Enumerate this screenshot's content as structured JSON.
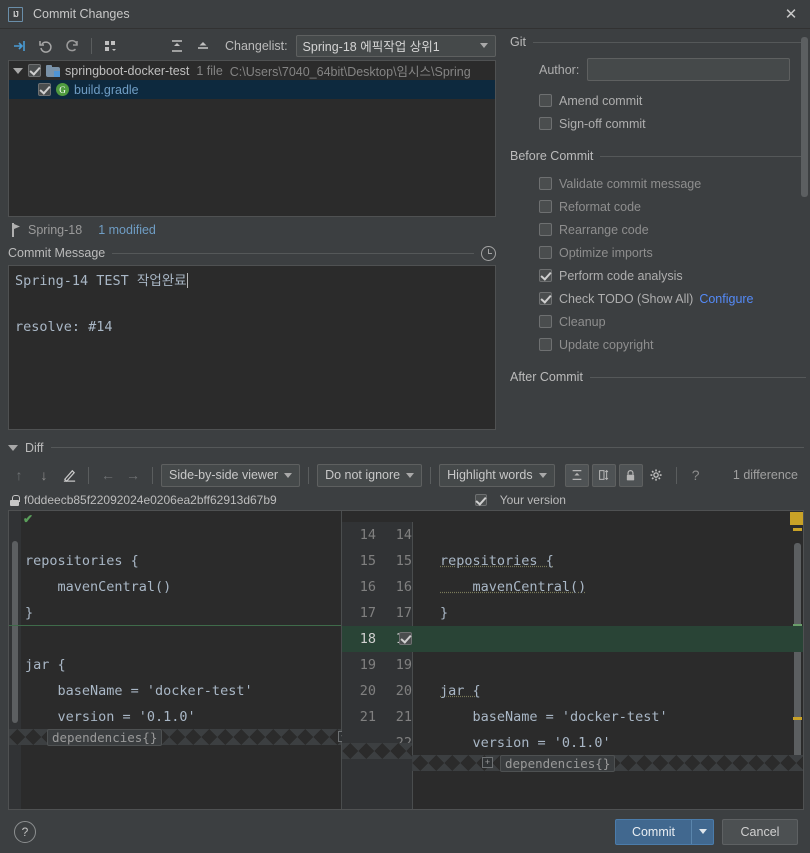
{
  "window": {
    "title": "Commit Changes",
    "logo": "ij-logo",
    "close": "✕"
  },
  "changes_toolbar": {
    "icons": [
      {
        "name": "show-diff-icon",
        "glyph": "⇥"
      },
      {
        "name": "revert-icon",
        "glyph": "↺"
      },
      {
        "name": "refresh-icon",
        "glyph": "⟳"
      },
      {
        "name": "group-by-icon",
        "glyph": "⣿"
      },
      {
        "name": "expand-all-icon",
        "glyph": "⤒"
      },
      {
        "name": "collapse-all-icon",
        "glyph": "⤓"
      }
    ],
    "changelist_label": "Changelist:",
    "changelist_value": "Spring-18 에픽작업 상위1"
  },
  "file_tree": {
    "root": {
      "name": "springboot-docker-test",
      "file_count": "1 file",
      "path": "C:\\Users\\7040_64bit\\Desktop\\임시스\\Spring",
      "checked": true,
      "expanded": true
    },
    "children": [
      {
        "name": "build.gradle",
        "checked": true,
        "selected": true,
        "icon": "gradle-file-icon"
      }
    ]
  },
  "branch_status": {
    "branch": "Spring-18",
    "modified": "1 modified"
  },
  "commit_message": {
    "label": "Commit Message",
    "history_icon": "clock-icon",
    "line1": "Spring-14 TEST 작업완료",
    "line2": "",
    "line3": "resolve: #14"
  },
  "git_group": {
    "title": "Git",
    "author_label": "Author:",
    "author_value": "",
    "author_placeholder": "",
    "options": [
      {
        "label": "Amend commit",
        "checked": false
      },
      {
        "label": "Sign-off commit",
        "checked": false
      }
    ]
  },
  "before_commit_group": {
    "title": "Before Commit",
    "options": [
      {
        "label": "Validate commit message",
        "checked": false
      },
      {
        "label": "Reformat code",
        "checked": false
      },
      {
        "label": "Rearrange code",
        "checked": false
      },
      {
        "label": "Optimize imports",
        "checked": false
      },
      {
        "label": "Perform code analysis",
        "checked": true
      },
      {
        "label": "Check TODO (Show All)",
        "checked": true,
        "link": "Configure"
      },
      {
        "label": "Cleanup",
        "checked": false
      },
      {
        "label": "Update copyright",
        "checked": false
      }
    ]
  },
  "after_commit_group": {
    "title": "After Commit"
  },
  "diff": {
    "title": "Diff",
    "toolbar": {
      "prev_diff": "↑",
      "next_diff": "↓",
      "edit": "✎",
      "accept_left": "←",
      "accept_right": "→",
      "viewer_mode": "Side-by-side viewer",
      "ignore_mode": "Do not ignore",
      "highlight_mode": "Highlight words",
      "collapse_unchanged": "⤒",
      "sync_scroll": "⫼",
      "lock": "🔒",
      "settings": "⚙",
      "help": "?",
      "difference_count": "1 difference"
    },
    "revision": {
      "hash": "f0ddeecb85f22092024e0206ea2bff62913d67b9",
      "your_version_label": "Your version",
      "your_version_checked": true
    },
    "left": {
      "lines": [
        {
          "num": "14",
          "text": ""
        },
        {
          "num": "15",
          "text": "repositories {"
        },
        {
          "num": "16",
          "text": "    mavenCentral()"
        },
        {
          "num": "17",
          "text": "}"
        },
        {
          "num": "18",
          "text": ""
        },
        {
          "num": "19",
          "text": "jar {"
        },
        {
          "num": "20",
          "text": "    baseName = 'docker-test'"
        },
        {
          "num": "21",
          "text": "    version = '0.1.0'"
        }
      ],
      "fold_label": "dependencies{}"
    },
    "right": {
      "lines": [
        {
          "num": "14",
          "text": ""
        },
        {
          "num": "15",
          "text": "repositories {"
        },
        {
          "num": "16",
          "text": "    mavenCentral()"
        },
        {
          "num": "17",
          "text": "}"
        },
        {
          "num": "18",
          "text": "",
          "changed": true,
          "checked": true
        },
        {
          "num": "19",
          "text": ""
        },
        {
          "num": "20",
          "text": "jar {"
        },
        {
          "num": "21",
          "text": "    baseName = 'docker-test'"
        },
        {
          "num": "22",
          "text": "    version = '0.1.0'"
        }
      ],
      "fold_label": "dependencies{}"
    }
  },
  "footer": {
    "help": "?",
    "commit_label": "Commit",
    "cancel_label": "Cancel"
  },
  "colors": {
    "accent_blue": "#41688f",
    "link_blue": "#548af7",
    "added_green": "#294436",
    "string_green": "#6a8759",
    "keyword_orange": "#cc7832",
    "marker_yellow": "#c9a227",
    "selection_blue": "#0d293e",
    "panel_bg": "#3c3f41",
    "editor_bg": "#2b2b2b"
  }
}
